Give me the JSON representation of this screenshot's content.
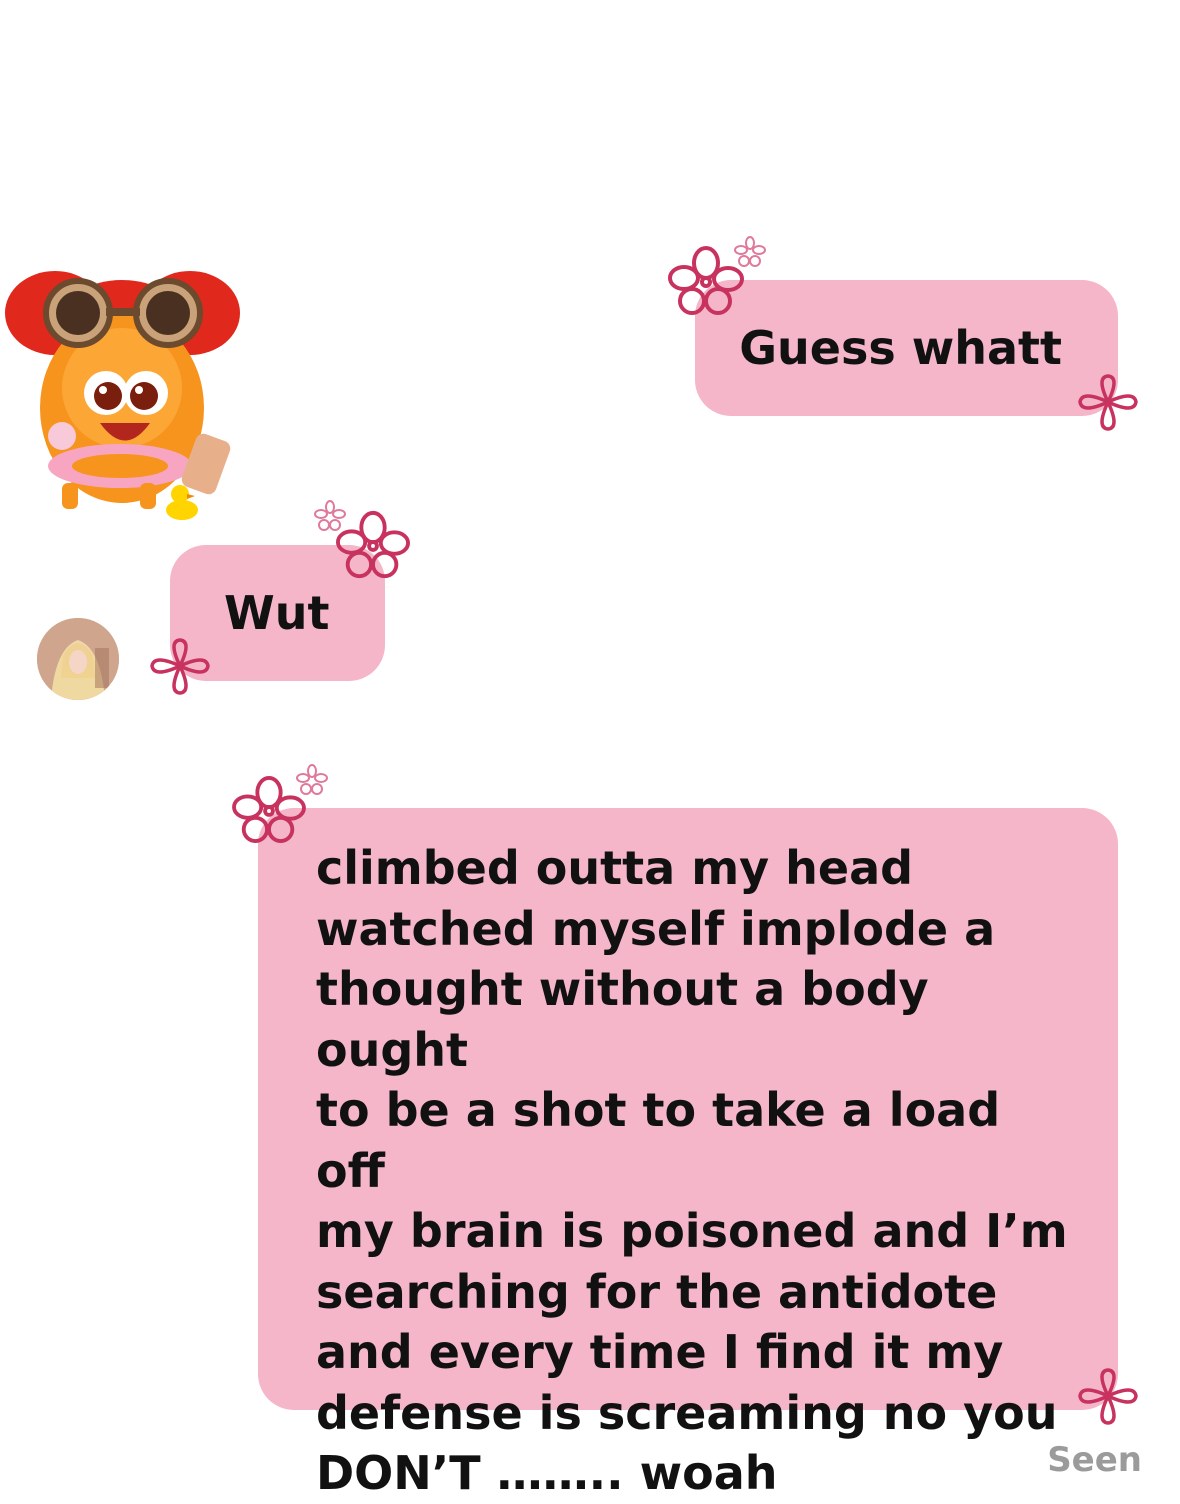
{
  "messages": [
    {
      "sender": "me",
      "text": "Guess whatt"
    },
    {
      "sender": "them",
      "text": "Wut"
    },
    {
      "sender": "me",
      "text": "climbed outta my head\nwatched myself implode a\nthought without a body ought\nto be a shot to take a load off\nmy brain is poisoned and I’m\nsearching for the antidote\nand every time I find it my\ndefense is screaming no you\nDON’T …….. woah"
    }
  ],
  "status": {
    "seen_label": "Seen"
  },
  "colors": {
    "bubble": "#f4b6c8",
    "flower": "#c8325f",
    "text": "#111111",
    "seen": "#9b9b9b",
    "background": "#ffffff"
  },
  "icons": {
    "sticker": "orange-monster-sticker",
    "avatar": "contact-avatar",
    "flower": "pink-flower-doodle"
  }
}
